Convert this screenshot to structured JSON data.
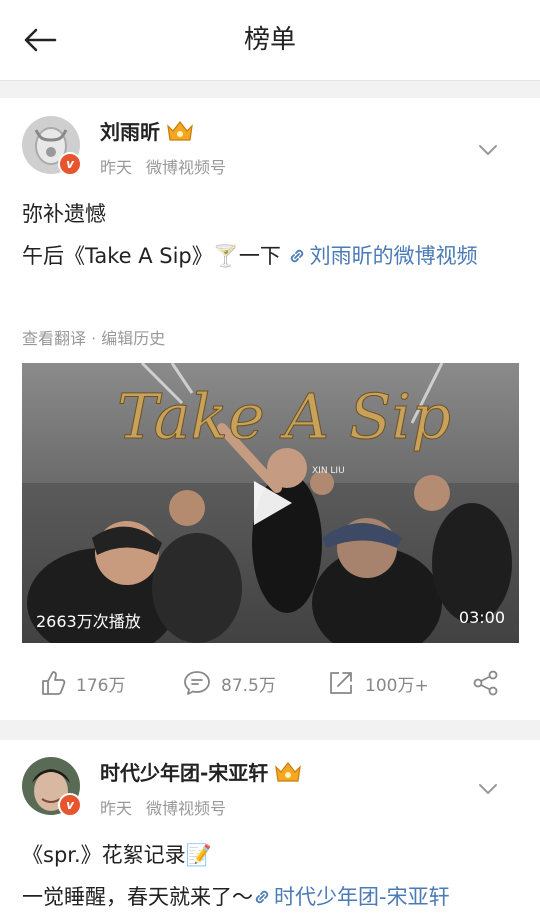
{
  "header": {
    "title": "榜单"
  },
  "posts": [
    {
      "username": "刘雨昕",
      "time": "昨天",
      "source": "微博视频号",
      "text_line1": "弥补遗憾",
      "text_line2_prefix": "午后《Take A Sip》🍸一下",
      "text_link": "刘雨昕的微博视频",
      "translate": "查看翻译",
      "edit_history": "编辑历史",
      "video": {
        "title_art": "Take A Sip",
        "subtitle_art": "XIN LIU",
        "plays": "2663万次播放",
        "duration": "03:00"
      },
      "likes": "176万",
      "comments": "87.5万",
      "reposts": "100万+"
    },
    {
      "username": "时代少年团-宋亚轩",
      "time": "昨天",
      "source": "微博视频号",
      "text_line1": "《spr.》花絮记录📝",
      "text_line2_prefix": "一觉睡醒，春天就来了～",
      "text_link": "时代少年团-宋亚轩"
    }
  ],
  "colors": {
    "link": "#4a7bb7",
    "badge": "#e8542d",
    "meta": "#999999"
  },
  "icons": [
    "back-arrow-icon",
    "verified-badge-icon",
    "crown-icon",
    "chevron-down-icon",
    "link-icon",
    "play-icon",
    "like-icon",
    "comment-icon",
    "repost-icon",
    "share-icon"
  ]
}
